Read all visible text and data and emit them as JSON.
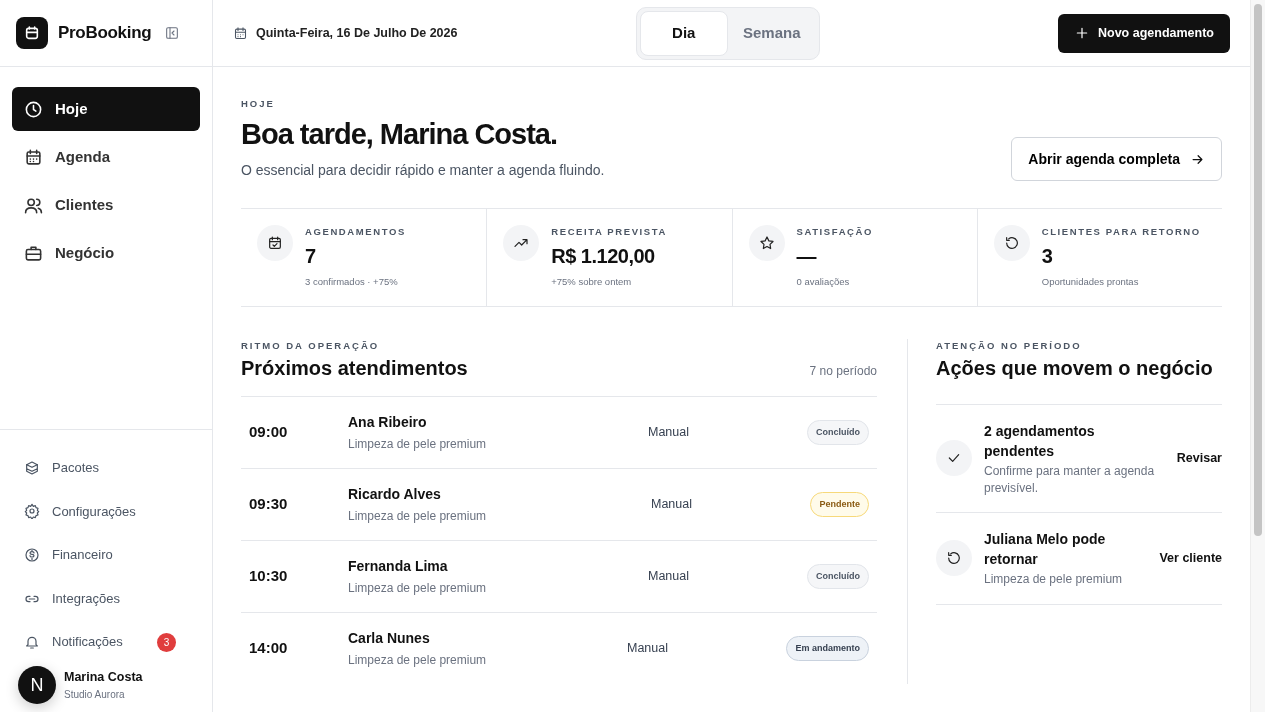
{
  "brand": {
    "name": "ProBooking"
  },
  "header": {
    "date": "Quinta-Feira, 16 De Julho De 2026",
    "view_tabs": [
      {
        "label": "Dia",
        "selected": true
      },
      {
        "label": "Semana",
        "selected": false
      }
    ],
    "new_button": "Novo agendamento"
  },
  "sidebar": {
    "main_items": [
      {
        "label": "Hoje",
        "selected": true
      },
      {
        "label": "Agenda",
        "selected": false
      },
      {
        "label": "Clientes",
        "selected": false
      },
      {
        "label": "Negócio",
        "selected": false
      }
    ],
    "secondary_items": [
      {
        "label": "Pacotes"
      },
      {
        "label": "Configurações"
      },
      {
        "label": "Financeiro"
      },
      {
        "label": "Integrações"
      },
      {
        "label": "Notificações",
        "badge": "3"
      }
    ],
    "user": {
      "initial": "N",
      "name": "Marina Costa",
      "company": "Studio Aurora"
    }
  },
  "hero": {
    "eyebrow": "HOJE",
    "title": "Boa tarde, Marina Costa.",
    "subtitle": "O essencial para decidir rápido e manter a agenda fluindo.",
    "button": "Abrir agenda completa"
  },
  "stats": [
    {
      "label": "AGENDAMENTOS",
      "value": "7",
      "note": "3 confirmados · +75%"
    },
    {
      "label": "RECEITA PREVISTA",
      "value": "R$ 1.120,00",
      "note": "+75% sobre ontem"
    },
    {
      "label": "SATISFAÇÃO",
      "value": "—",
      "note": "0 avaliações"
    },
    {
      "label": "CLIENTES PARA RETORNO",
      "value": "3",
      "note": "Oportunidades prontas"
    }
  ],
  "appointments": {
    "eyebrow": "RITMO DA OPERAÇÃO",
    "title": "Próximos atendimentos",
    "count": "7 no período",
    "rows": [
      {
        "time": "09:00",
        "client": "Ana Ribeiro",
        "service": "Limpeza de pele premium",
        "source": "Manual",
        "status": "Concluído",
        "kind": "done"
      },
      {
        "time": "09:30",
        "client": "Ricardo Alves",
        "service": "Limpeza de pele premium",
        "source": "Manual",
        "status": "Pendente",
        "kind": "pending"
      },
      {
        "time": "10:30",
        "client": "Fernanda Lima",
        "service": "Limpeza de pele premium",
        "source": "Manual",
        "status": "Concluído",
        "kind": "done"
      },
      {
        "time": "14:00",
        "client": "Carla Nunes",
        "service": "Limpeza de pele premium",
        "source": "Manual",
        "status": "Em andamento",
        "kind": "progress"
      }
    ]
  },
  "attention": {
    "eyebrow": "ATENÇÃO NO PERÍODO",
    "title": "Ações que movem o negócio",
    "items": [
      {
        "title": "2 agendamentos pendentes",
        "text": "Confirme para manter a agenda previsível.",
        "action": "Revisar"
      },
      {
        "title": "Juliana Melo pode retornar",
        "text": "Limpeza de pele premium",
        "action": "Ver cliente"
      }
    ]
  }
}
